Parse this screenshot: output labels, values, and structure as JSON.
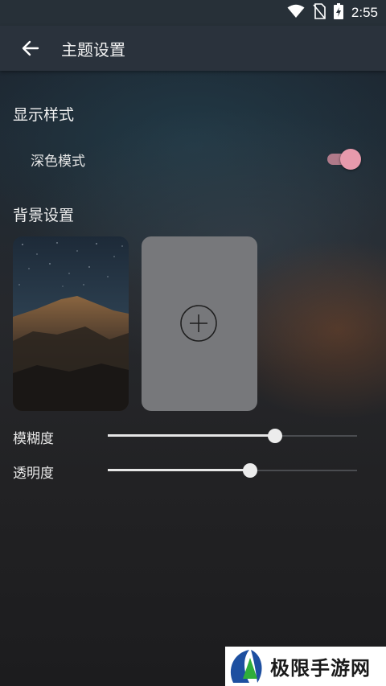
{
  "status_bar": {
    "time": "2:55"
  },
  "app_bar": {
    "title": "主题设置"
  },
  "display_style": {
    "heading": "显示样式",
    "dark_mode_label": "深色模式",
    "dark_mode_on": true
  },
  "background": {
    "heading": "背景设置",
    "blur_label": "模糊度",
    "blur_value_percent": 67,
    "opacity_label": "透明度",
    "opacity_value_percent": 57
  },
  "watermark": {
    "text": "极限手游网"
  },
  "colors": {
    "toggle_accent": "#e79aac",
    "app_bar": "#2a323c"
  }
}
